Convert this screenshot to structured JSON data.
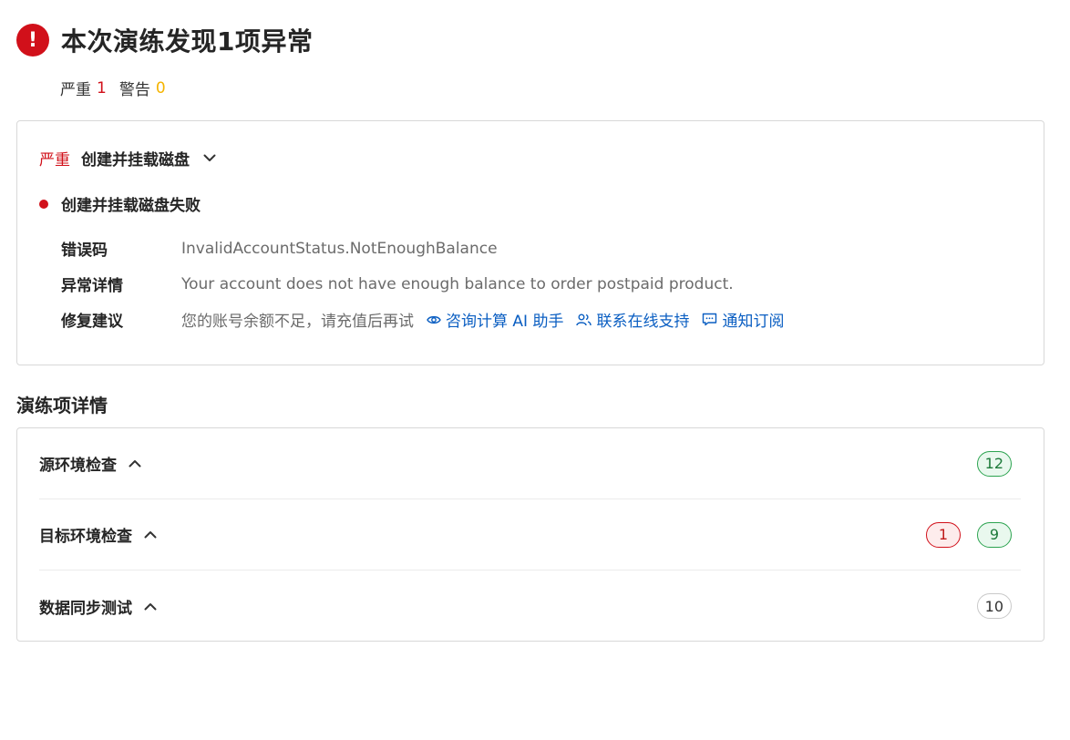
{
  "header": {
    "alert_symbol": "!",
    "title": "本次演练发现1项异常",
    "counts": {
      "severe_label": "严重",
      "severe_count": "1",
      "warning_label": "警告",
      "warning_count": "0"
    }
  },
  "issue": {
    "severity": "严重",
    "name": "创建并挂载磁盘",
    "failure_title": "创建并挂载磁盘失败",
    "details": [
      {
        "label": "错误码",
        "value": "InvalidAccountStatus.NotEnoughBalance"
      },
      {
        "label": "异常详情",
        "value": "Your account does not have enough balance to order postpaid product."
      },
      {
        "label": "修复建议",
        "value": "您的账号余额不足，请充值后再试"
      }
    ],
    "links": [
      {
        "label": "咨询计算 AI 助手",
        "icon": "eye-icon"
      },
      {
        "label": "联系在线支持",
        "icon": "users-icon"
      },
      {
        "label": "通知订阅",
        "icon": "message-icon"
      }
    ]
  },
  "items_section": {
    "title": "演练项详情",
    "items": [
      {
        "label": "源环境检查",
        "badges": [
          {
            "value": "12",
            "status": "success"
          }
        ]
      },
      {
        "label": "目标环境检查",
        "badges": [
          {
            "value": "1",
            "status": "error"
          },
          {
            "value": "9",
            "status": "success"
          }
        ]
      },
      {
        "label": "数据同步测试",
        "badges": [
          {
            "value": "10",
            "status": "neutral"
          }
        ]
      }
    ]
  },
  "colors": {
    "danger": "#d1101a",
    "warning": "#f5b400",
    "link": "#0a5ec2",
    "success": "#2ba34f"
  }
}
